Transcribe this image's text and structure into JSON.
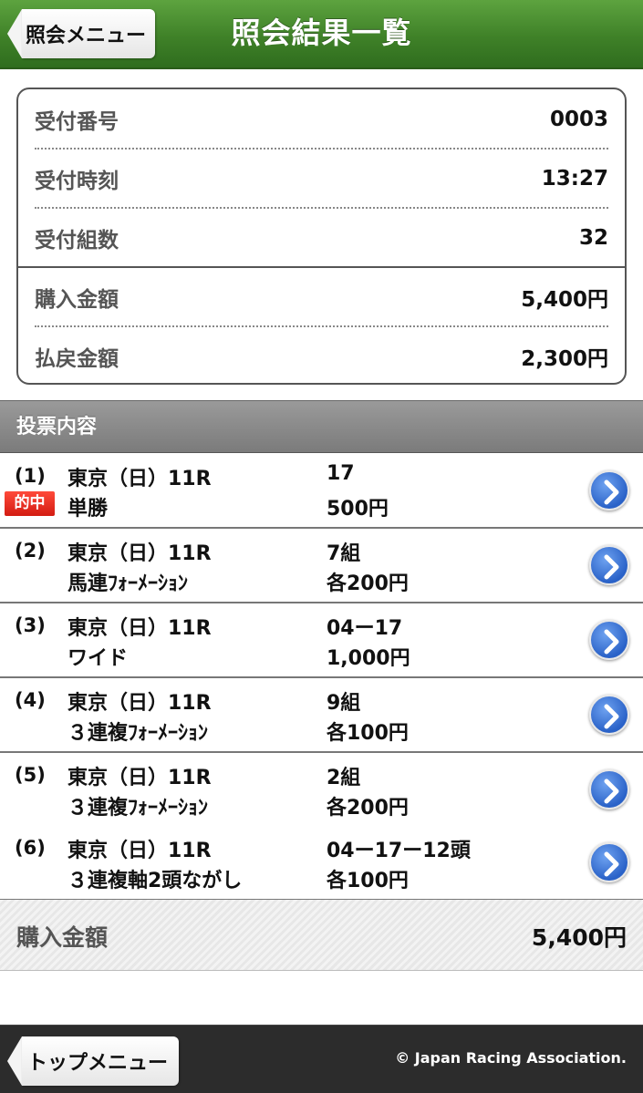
{
  "header": {
    "title": "照会結果一覧",
    "back_label": "照会メニュー"
  },
  "summary": {
    "rows": [
      {
        "label": "受付番号",
        "value": "0003"
      },
      {
        "label": "受付時刻",
        "value": "13:27"
      },
      {
        "label": "受付組数",
        "value": "32"
      },
      {
        "label": "購入金額",
        "value": "5,400円"
      },
      {
        "label": "払戻金額",
        "value": "2,300円"
      }
    ]
  },
  "section": {
    "title": "投票内容"
  },
  "bets": [
    {
      "num": "(1)",
      "race": "東京（日）11R",
      "type": "単勝",
      "selection": "17",
      "amount": "500円",
      "badge": "的中"
    },
    {
      "num": "(2)",
      "race": "東京（日）11R",
      "type": "馬連ﾌｫｰﾒｰｼｮﾝ",
      "selection": "7組",
      "amount": "各200円"
    },
    {
      "num": "(3)",
      "race": "東京（日）11R",
      "type": "ワイド",
      "selection": "04ー17",
      "amount": "1,000円"
    },
    {
      "num": "(4)",
      "race": "東京（日）11R",
      "type": "３連複ﾌｫｰﾒｰｼｮﾝ",
      "selection": "9組",
      "amount": "各100円"
    },
    {
      "num": "(5)",
      "race": "東京（日）11R",
      "type": "３連複ﾌｫｰﾒｰｼｮﾝ",
      "selection": "2組",
      "amount": "各200円"
    },
    {
      "num": "(6)",
      "race": "東京（日）11R",
      "type": "３連複軸2頭ながし",
      "selection": "04ー17ー12頭",
      "amount": "各100円"
    }
  ],
  "total": {
    "label": "購入金額",
    "value": "5,400円"
  },
  "footer": {
    "top_label": "トップメニュー",
    "copyright": "© Japan Racing Association."
  },
  "colors": {
    "header_green": "#3f8128",
    "hit_red": "#d31c12",
    "chevron_blue": "#2a62c8"
  }
}
